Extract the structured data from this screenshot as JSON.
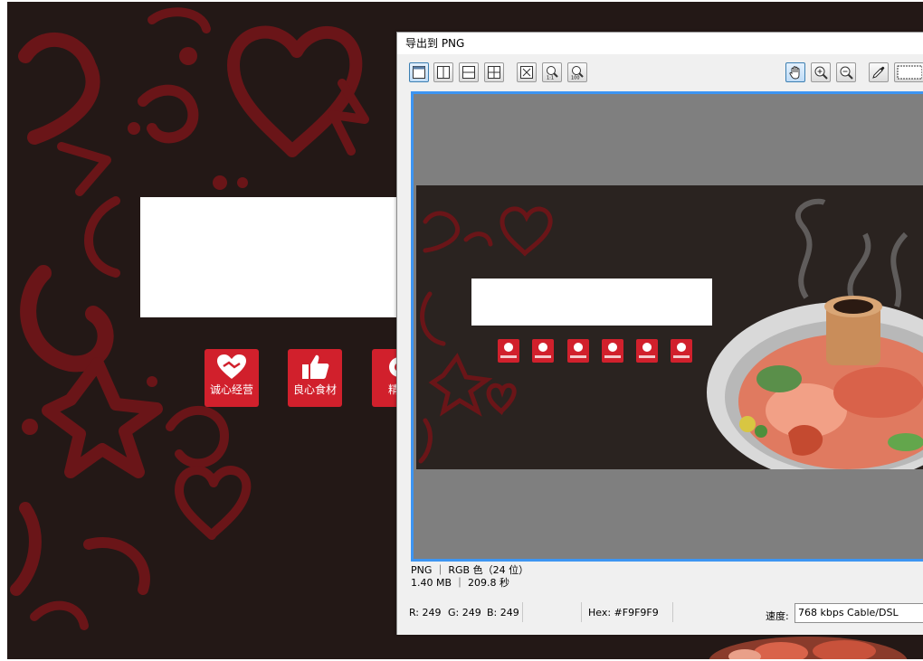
{
  "canvas": {
    "bg_color": "#231816",
    "accent_color": "#d1202c",
    "badges": [
      {
        "label": "诚心经营",
        "icon": "heart-handshake-icon"
      },
      {
        "label": "良心食材",
        "icon": "thumbs-up-icon"
      },
      {
        "label": "精心",
        "icon": "bowl-icon"
      }
    ]
  },
  "dialog": {
    "title": "导出到 PNG",
    "toolbar": {
      "left": [
        {
          "name": "view-single-icon",
          "active": true
        },
        {
          "name": "view-split-vertical-icon",
          "active": false
        },
        {
          "name": "view-split-horizontal-icon",
          "active": false
        },
        {
          "name": "view-quad-icon",
          "active": false
        },
        {
          "name": "fit-to-window-icon",
          "active": false
        },
        {
          "name": "zoom-1-1-icon",
          "active": false
        },
        {
          "name": "zoom-100-icon",
          "active": false
        }
      ],
      "right": [
        {
          "name": "hand-tool-icon",
          "active": true
        },
        {
          "name": "zoom-in-icon",
          "active": false
        },
        {
          "name": "zoom-out-icon",
          "active": false
        },
        {
          "name": "eyedropper-icon",
          "active": false
        },
        {
          "name": "color-swatch-icon",
          "active": false
        }
      ]
    },
    "info": {
      "format_line": "PNG ｜ RGB 色（24 位）",
      "size_line": "1.40 MB ｜ 209.8 秒"
    },
    "status": {
      "r": "R: 249",
      "g": "G: 249",
      "b": "B: 249",
      "hex": "Hex: #F9F9F9",
      "speed_label": "速度:",
      "speed_value": "768 kbps Cable/DSL"
    }
  }
}
